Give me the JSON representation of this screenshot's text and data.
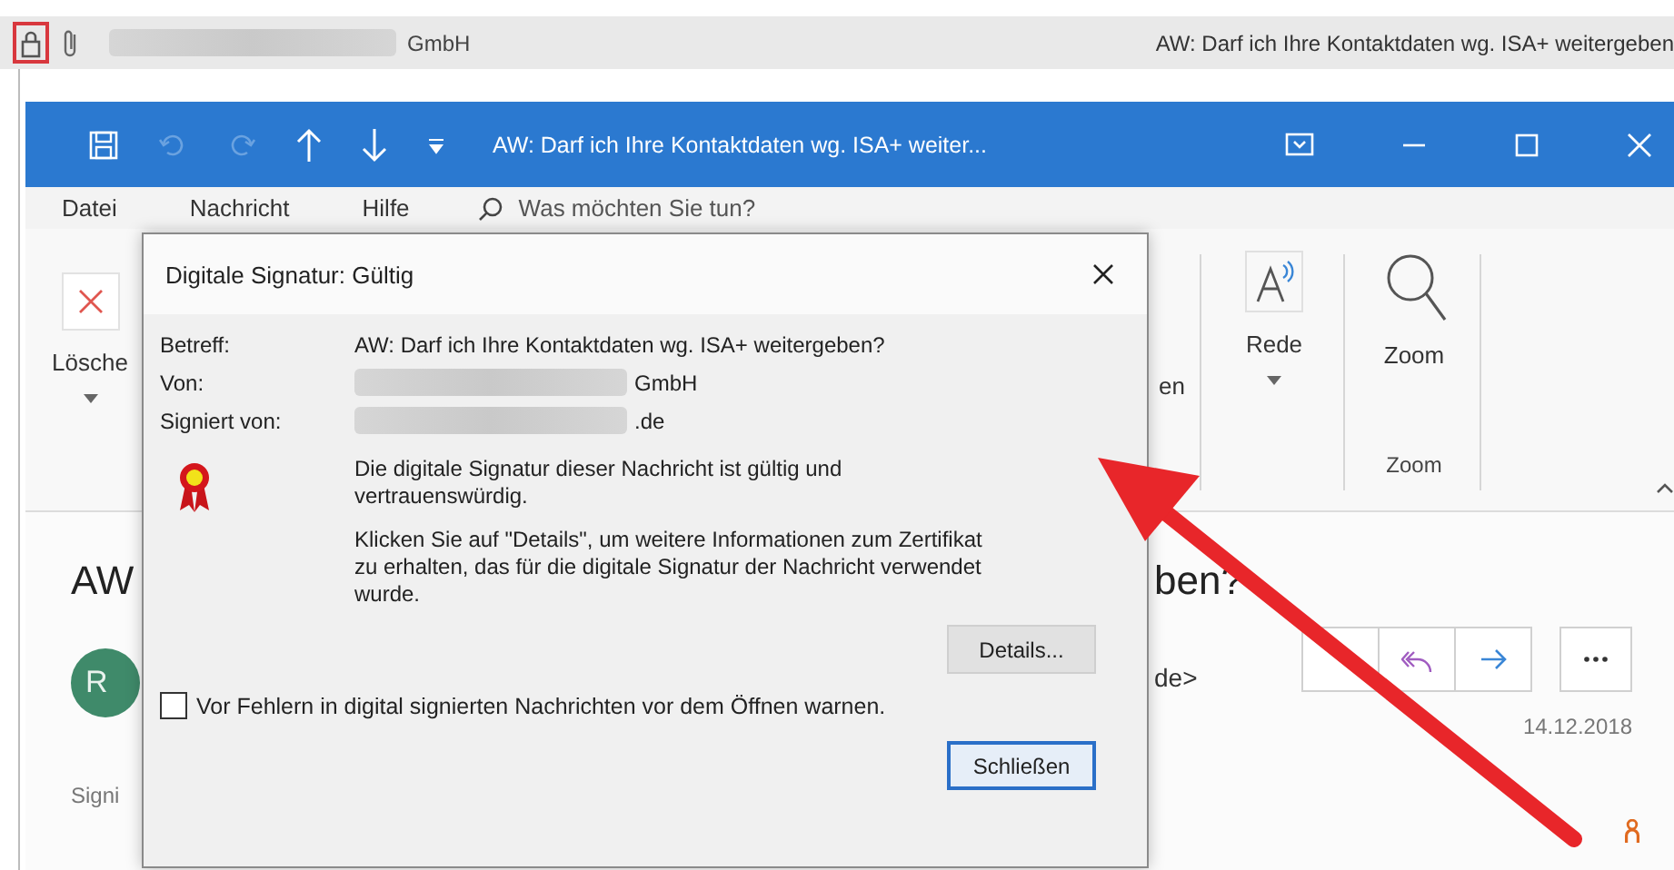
{
  "message_list_row": {
    "sender": "GmbH",
    "sender_redacted": true,
    "subject": "AW: Darf ich Ihre Kontaktdaten wg. ISA+ weitergeben"
  },
  "window": {
    "title": "AW: Darf ich Ihre Kontaktdaten wg. ISA+ weiter..."
  },
  "ribbon_tabs": [
    {
      "label": "Datei"
    },
    {
      "label": "Nachricht"
    },
    {
      "label": "Hilfe"
    }
  ],
  "search": {
    "placeholder": "Was möchten Sie tun?"
  },
  "ribbon": {
    "delete_label": "Lösche",
    "cut_label": "en",
    "speech_label": "Rede",
    "zoom_label": "Zoom",
    "zoom_group_label": "Zoom"
  },
  "message": {
    "subject_left": "AW",
    "subject_right": "ben?",
    "avatar_initial": "R",
    "sender_tail": "de>",
    "signed_label": "Signi",
    "date": "14.12.2018"
  },
  "dialog": {
    "title": "Digitale Signatur: Gültig",
    "fields": [
      {
        "label": "Betreff:",
        "value": "AW: Darf ich Ihre Kontaktdaten wg. ISA+ weitergeben?",
        "redacted": false
      },
      {
        "label": "Von:",
        "value": "GmbH",
        "redacted": true
      },
      {
        "label": "Signiert von:",
        "value": ".de",
        "redacted": true
      }
    ],
    "paragraphs": [
      "Die digitale Signatur dieser Nachricht ist gültig und vertrauenswürdig.",
      "Klicken Sie auf \"Details\", um weitere Informationen zum Zertifikat zu erhalten, das für die digitale Signatur der Nachricht verwendet wurde."
    ],
    "details_button": "Details...",
    "checkbox": {
      "label": "Vor Fehlern in digital signierten Nachrichten vor dem Öffnen warnen.",
      "checked": false
    },
    "close_button": "Schließen"
  }
}
